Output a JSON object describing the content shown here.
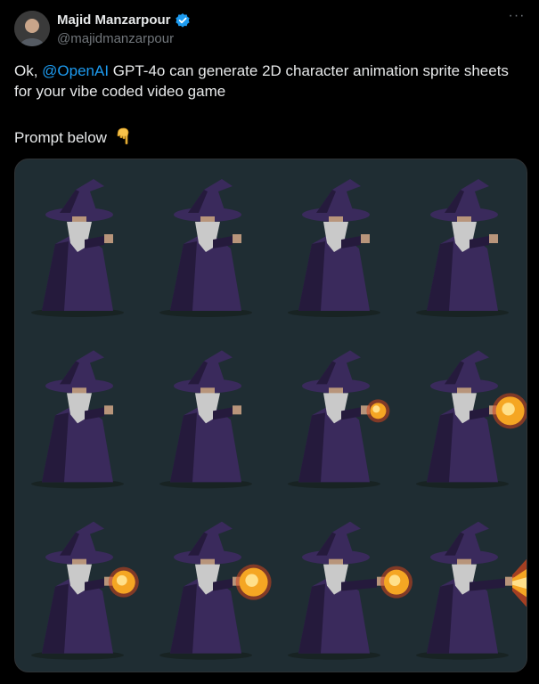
{
  "author": {
    "display_name": "Majid Manzarpour",
    "handle": "@majidmanzarpour",
    "verified": true
  },
  "tweet": {
    "text_before_mention": "Ok, ",
    "mention": "@OpenAI",
    "text_after_mention": " GPT-4o can generate 2D character animation sprite sheets for your vibe coded video game",
    "prompt_line": "Prompt below",
    "prompt_emoji": "pointing-down-emoji"
  },
  "more_menu": {
    "label": "···"
  },
  "media": {
    "description_kind": "sprite-sheet",
    "rows": 3,
    "columns": 4,
    "frames": [
      {
        "row": 1,
        "col": 1,
        "fireball": "none"
      },
      {
        "row": 1,
        "col": 2,
        "fireball": "none"
      },
      {
        "row": 1,
        "col": 3,
        "fireball": "none"
      },
      {
        "row": 1,
        "col": 4,
        "fireball": "none"
      },
      {
        "row": 2,
        "col": 1,
        "fireball": "none"
      },
      {
        "row": 2,
        "col": 2,
        "fireball": "none"
      },
      {
        "row": 2,
        "col": 3,
        "fireball": "small"
      },
      {
        "row": 2,
        "col": 4,
        "fireball": "large"
      },
      {
        "row": 3,
        "col": 1,
        "fireball": "medium"
      },
      {
        "row": 3,
        "col": 2,
        "fireball": "large"
      },
      {
        "row": 3,
        "col": 3,
        "fireball": "cast"
      },
      {
        "row": 3,
        "col": 4,
        "fireball": "blast"
      }
    ]
  },
  "colors": {
    "background": "#000000",
    "text": "#e7e9ea",
    "secondary_text": "#71767b",
    "link": "#1d9bf0",
    "verified": "#1d9bf0",
    "sprite_background": "#1f2d33",
    "robe": "#3a2a5c",
    "robe_shadow": "#251a3c",
    "beard": "#c9c9c9",
    "fire": "#f5a623"
  }
}
